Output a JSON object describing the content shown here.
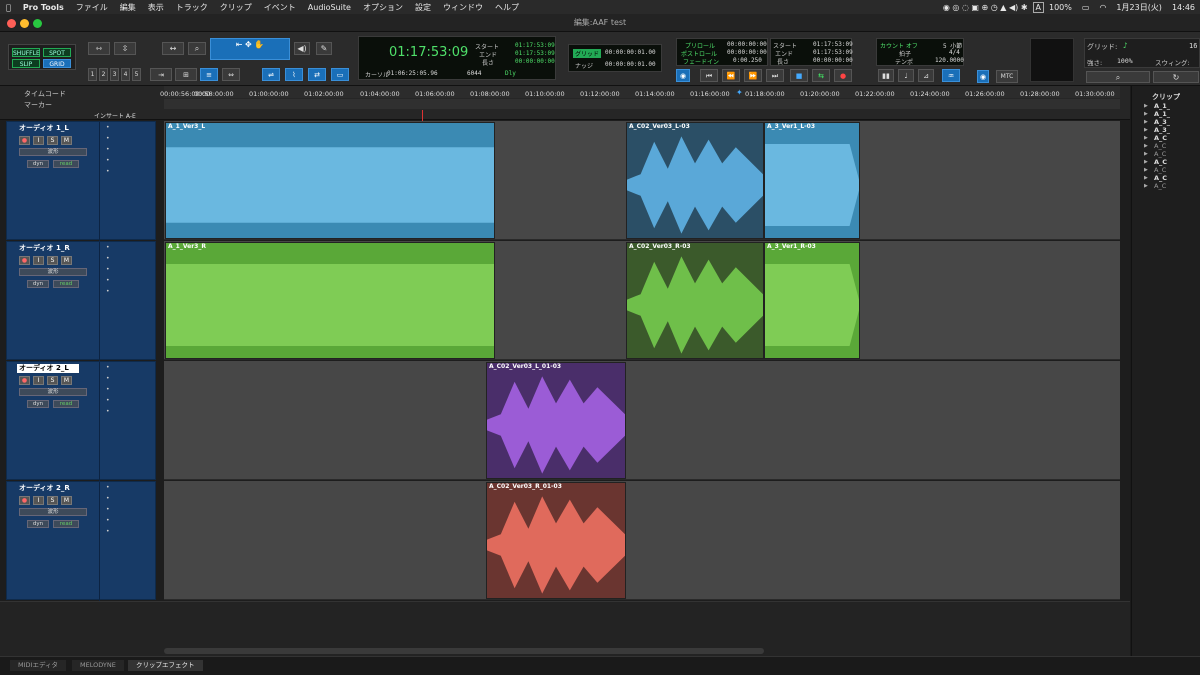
{
  "menubar": {
    "app": "Pro Tools",
    "items": [
      "ファイル",
      "編集",
      "表示",
      "トラック",
      "クリップ",
      "イベント",
      "AudioSuite",
      "オプション",
      "設定",
      "ウィンドウ",
      "ヘルプ"
    ],
    "right": {
      "battery": "100%",
      "date": "1月23日(火)",
      "time": "14:46",
      "input": "A"
    }
  },
  "window": {
    "title": "編集:AAF test"
  },
  "toolbar": {
    "modes": {
      "shuffle": "SHUFFLE",
      "spot": "SPOT",
      "slip": "SLIP",
      "grid": "GRID"
    },
    "zoom_presets": [
      "1",
      "2",
      "3",
      "4",
      "5"
    ],
    "main_counter": "01:17:53:09",
    "cursor_label": "カーソル",
    "cursor_value": "01:06:25:05.96",
    "cursor_extra": "6044",
    "dly": "Dly",
    "sel": {
      "start_label": "スタート",
      "end_label": "エンド",
      "length_label": "長さ",
      "start": "01:17:53:09",
      "end": "01:17:53:09",
      "length": "00:00:00:00"
    },
    "grid_box": {
      "grid_label": "グリッド",
      "grid_value": "00:00:00:01.00",
      "nudge_label": "ナッジ",
      "nudge_value": "00:00:00:01.00"
    },
    "pre": {
      "preroll_label": "プリロール",
      "postroll_label": "ポストロール",
      "fadein_label": "フェードイン",
      "preroll": "00:00:00:00",
      "postroll": "00:00:00:00",
      "fadein": "0:00.250"
    },
    "transport_sel": {
      "start_label": "スタート",
      "end_label": "エンド",
      "length_label": "長さ",
      "start": "01:17:53:09",
      "end": "01:17:53:09",
      "length": "00:00:00:00"
    },
    "count": {
      "count_off": "カウント オフ",
      "bars": "5 小節",
      "meter_label": "拍子",
      "meter": "4/4",
      "tempo_label": "テンポ",
      "tempo": "120.0000"
    },
    "mtc": "MTC",
    "grid_right": {
      "label": "グリッド:",
      "strength_label": "強さ:",
      "strength": "100%",
      "swing_label": "スウィング:",
      "value": "16"
    }
  },
  "rulers": {
    "timecode_label": "タイムコード",
    "marker_label": "マーカー",
    "ticks": [
      "00:00:56:00:00",
      "00:58:00:00",
      "01:00:00:00",
      "01:02:00:00",
      "01:04:00:00",
      "01:06:00:00",
      "01:08:00:00",
      "01:10:00:00",
      "01:12:00:00",
      "01:14:00:00",
      "01:16:00:00",
      "01:18:00:00",
      "01:20:00:00",
      "01:22:00:00",
      "01:24:00:00",
      "01:26:00:00",
      "01:28:00:00",
      "01:30:00:00"
    ],
    "insert_header": "インサート A-E"
  },
  "tracks": [
    {
      "name": "オーディオ 1_L",
      "view": "波形",
      "dyn": "dyn",
      "read": "read",
      "selected": false,
      "clips": [
        {
          "name": "A_1_Ver3_L",
          "color": "#4a9fcc"
        },
        {
          "name": "A_C02_Ver03_L-03",
          "color": "#4a9fcc"
        },
        {
          "name": "A_3_Ver1_L-03",
          "color": "#4a9fcc"
        }
      ]
    },
    {
      "name": "オーディオ 1_R",
      "view": "波形",
      "dyn": "dyn",
      "read": "read",
      "selected": false,
      "clips": [
        {
          "name": "A_1_Ver3_R",
          "color": "#6fbf4a"
        },
        {
          "name": "A_C02_Ver03_R-03",
          "color": "#6fbf4a"
        },
        {
          "name": "A_3_Ver1_R-03",
          "color": "#6fbf4a"
        }
      ]
    },
    {
      "name": "オーディオ 2_L",
      "view": "波形",
      "dyn": "dyn",
      "read": "read",
      "selected": true,
      "clips": [
        {
          "name": "A_C02_Ver03_L_01-03",
          "color": "#9b5cd6"
        }
      ]
    },
    {
      "name": "オーディオ 2_R",
      "view": "波形",
      "dyn": "dyn",
      "read": "read",
      "selected": false,
      "clips": [
        {
          "name": "A_C02_Ver03_R_01-03",
          "color": "#e06a5c"
        }
      ]
    }
  ],
  "track_buttons": {
    "rec": "●",
    "input": "I",
    "solo": "S",
    "mute": "M"
  },
  "clips_panel": {
    "title": "クリップ",
    "items": [
      {
        "name": "A_1_",
        "bold": true
      },
      {
        "name": "A_1_",
        "bold": true
      },
      {
        "name": "A_3_",
        "bold": true
      },
      {
        "name": "A_3_",
        "bold": true
      },
      {
        "name": "A_C",
        "bold": true
      },
      {
        "name": "A_C",
        "bold": false
      },
      {
        "name": "A_C",
        "bold": false
      },
      {
        "name": "A_C",
        "bold": true
      },
      {
        "name": "A_C",
        "bold": false
      },
      {
        "name": "A_C",
        "bold": true
      },
      {
        "name": "A_C",
        "bold": false
      }
    ]
  },
  "bottom_tabs": [
    "MIDIエディタ",
    "MELODYNE",
    "クリップエフェクト"
  ]
}
